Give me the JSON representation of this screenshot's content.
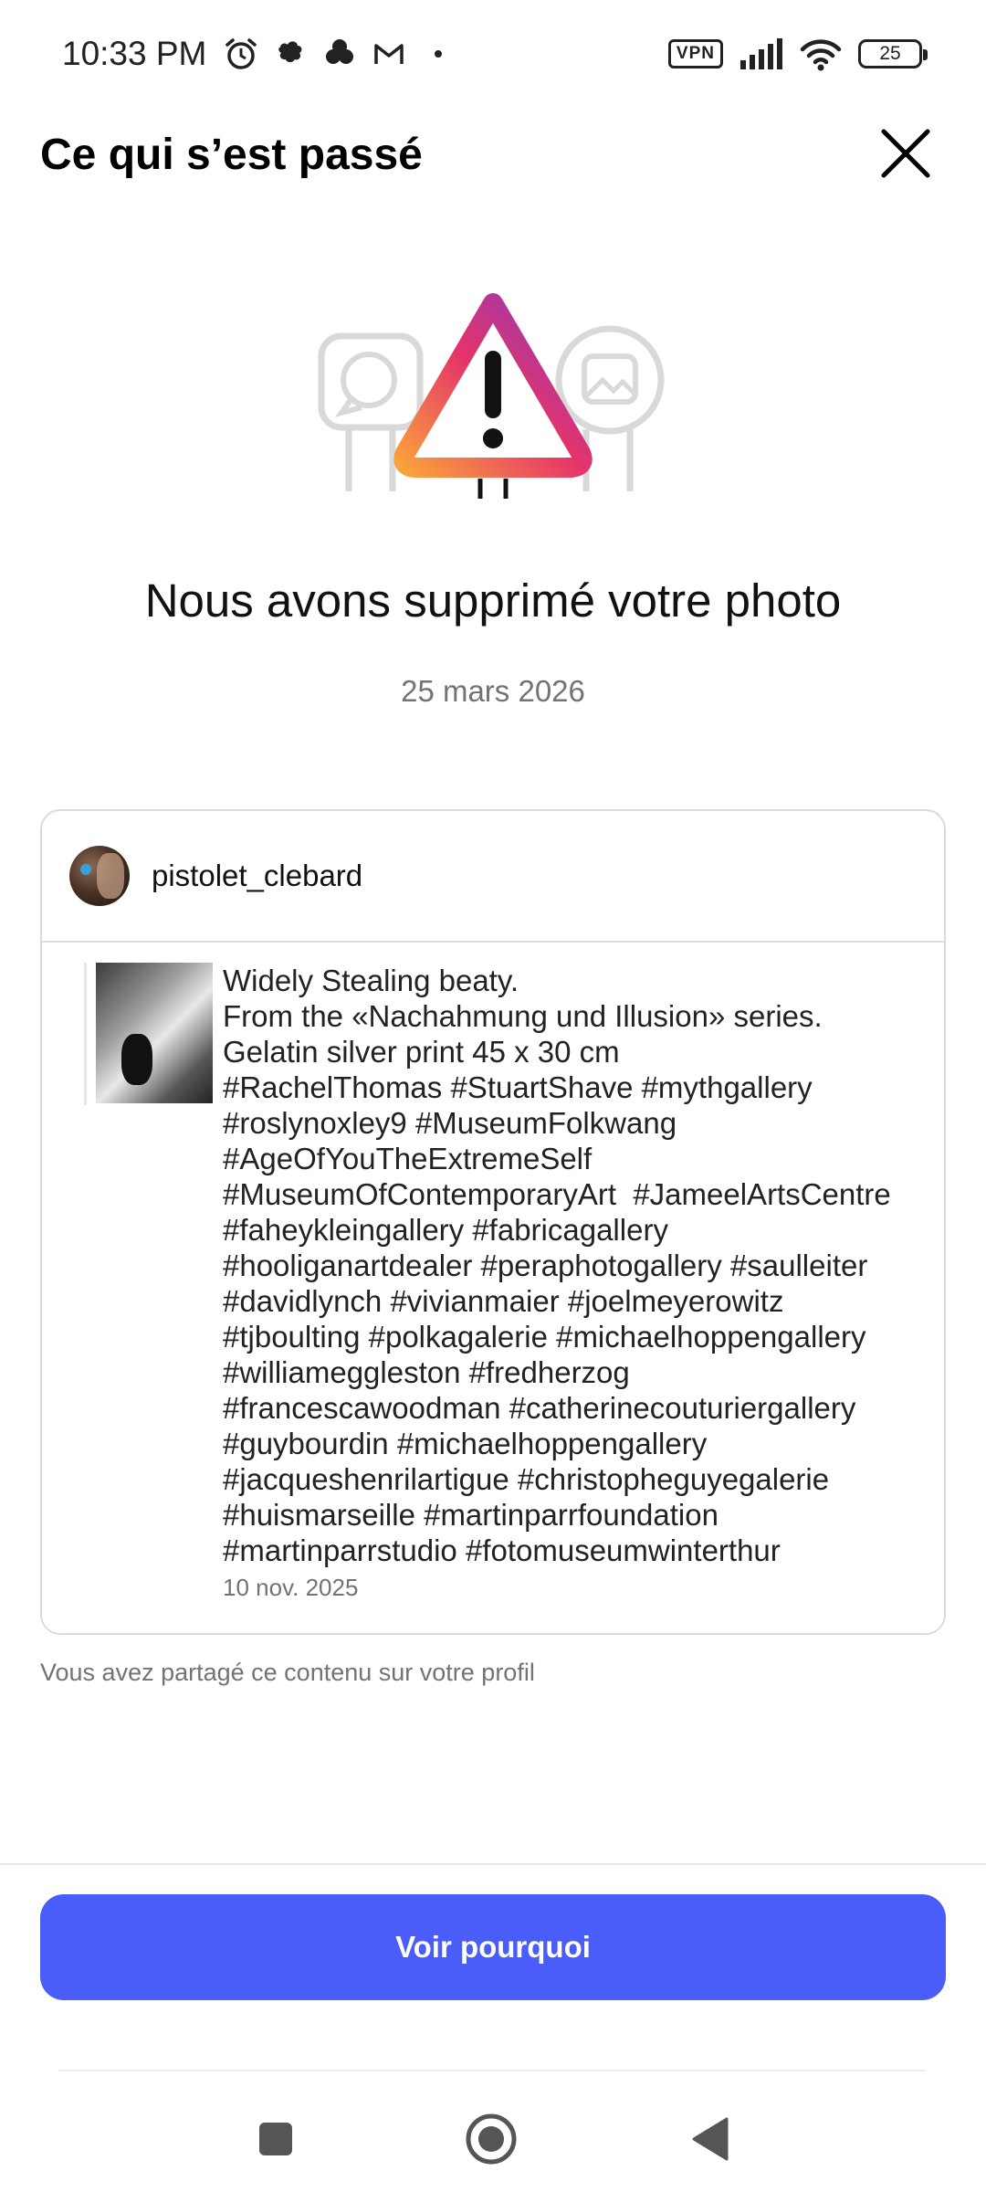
{
  "status_bar": {
    "time": "10:33 PM",
    "vpn": "VPN",
    "battery": "25",
    "icons": [
      "alarm-icon",
      "notification-icon",
      "notification-icon",
      "gmail-icon",
      "dot-icon",
      "signal-icon",
      "wifi-icon",
      "battery-icon"
    ]
  },
  "header": {
    "title": "Ce qui s’est passé",
    "close_icon": "close-icon"
  },
  "illustration": {
    "icon": "warning-triangle-icon",
    "accent_colors": [
      "#f9a13b",
      "#e6336b",
      "#8a3ab9"
    ]
  },
  "notice": {
    "headline": "Nous avons supprimé votre photo",
    "date": "25 mars 2026"
  },
  "post": {
    "username": "pistolet_clebard",
    "caption_lines": [
      "Widely Stealing beaty.",
      "From the «Nachahmung und Illusion» series.",
      "Gelatin silver print 45 x 30 cm",
      "#RachelThomas #StuartShave #mythgallery",
      "#roslynoxley9 #MuseumFolkwang",
      "#AgeOfYouTheExtremeSelf",
      "#MuseumOfContemporaryArt  #JameelArtsCentre",
      "#faheykleingallery #fabricagallery",
      "#hooliganartdealer #peraphotogallery #saulleiter",
      "#davidlynch #vivianmaier #joelmeyerowitz",
      "#tjboulting #polkagalerie #michaelhoppengallery",
      "#williameggleston #fredherzog",
      "#francescawoodman #catherinecouturiergallery",
      "#guybourdin #michaelhoppengallery",
      "#jacqueshenrilartigue #christopheguyegalerie",
      "#huismarseille #martinparrfoundation",
      "#martinparrstudio #fotomuseumwinterthur"
    ],
    "date": "10 nov. 2025"
  },
  "shared_note": "Vous avez partagé ce contenu sur votre profil",
  "cta": {
    "label": "Voir pourquoi",
    "color": "#4a5df9"
  },
  "nav": {
    "recents_icon": "square-icon",
    "home_icon": "home-circle-icon",
    "back_icon": "back-triangle-icon"
  }
}
